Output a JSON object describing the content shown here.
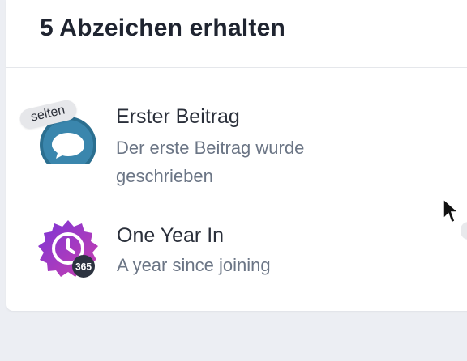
{
  "header": {
    "title": "5 Abzeichen erhalten"
  },
  "badges": [
    {
      "title": "Erster Beitrag",
      "description": "Der erste Beitrag wurde geschrieben",
      "tag": "selten",
      "icon": "speech-bubble-icon",
      "color": "#2e7da6"
    },
    {
      "title": "One Year In",
      "description": "A year since joining",
      "icon": "clock-icon",
      "badge_number": "365",
      "color": "#9b3fcf"
    }
  ],
  "colors": {
    "page_bg": "#eceef3",
    "card_bg": "#ffffff",
    "title_text": "#1f2430",
    "muted_text": "#6b7585"
  }
}
